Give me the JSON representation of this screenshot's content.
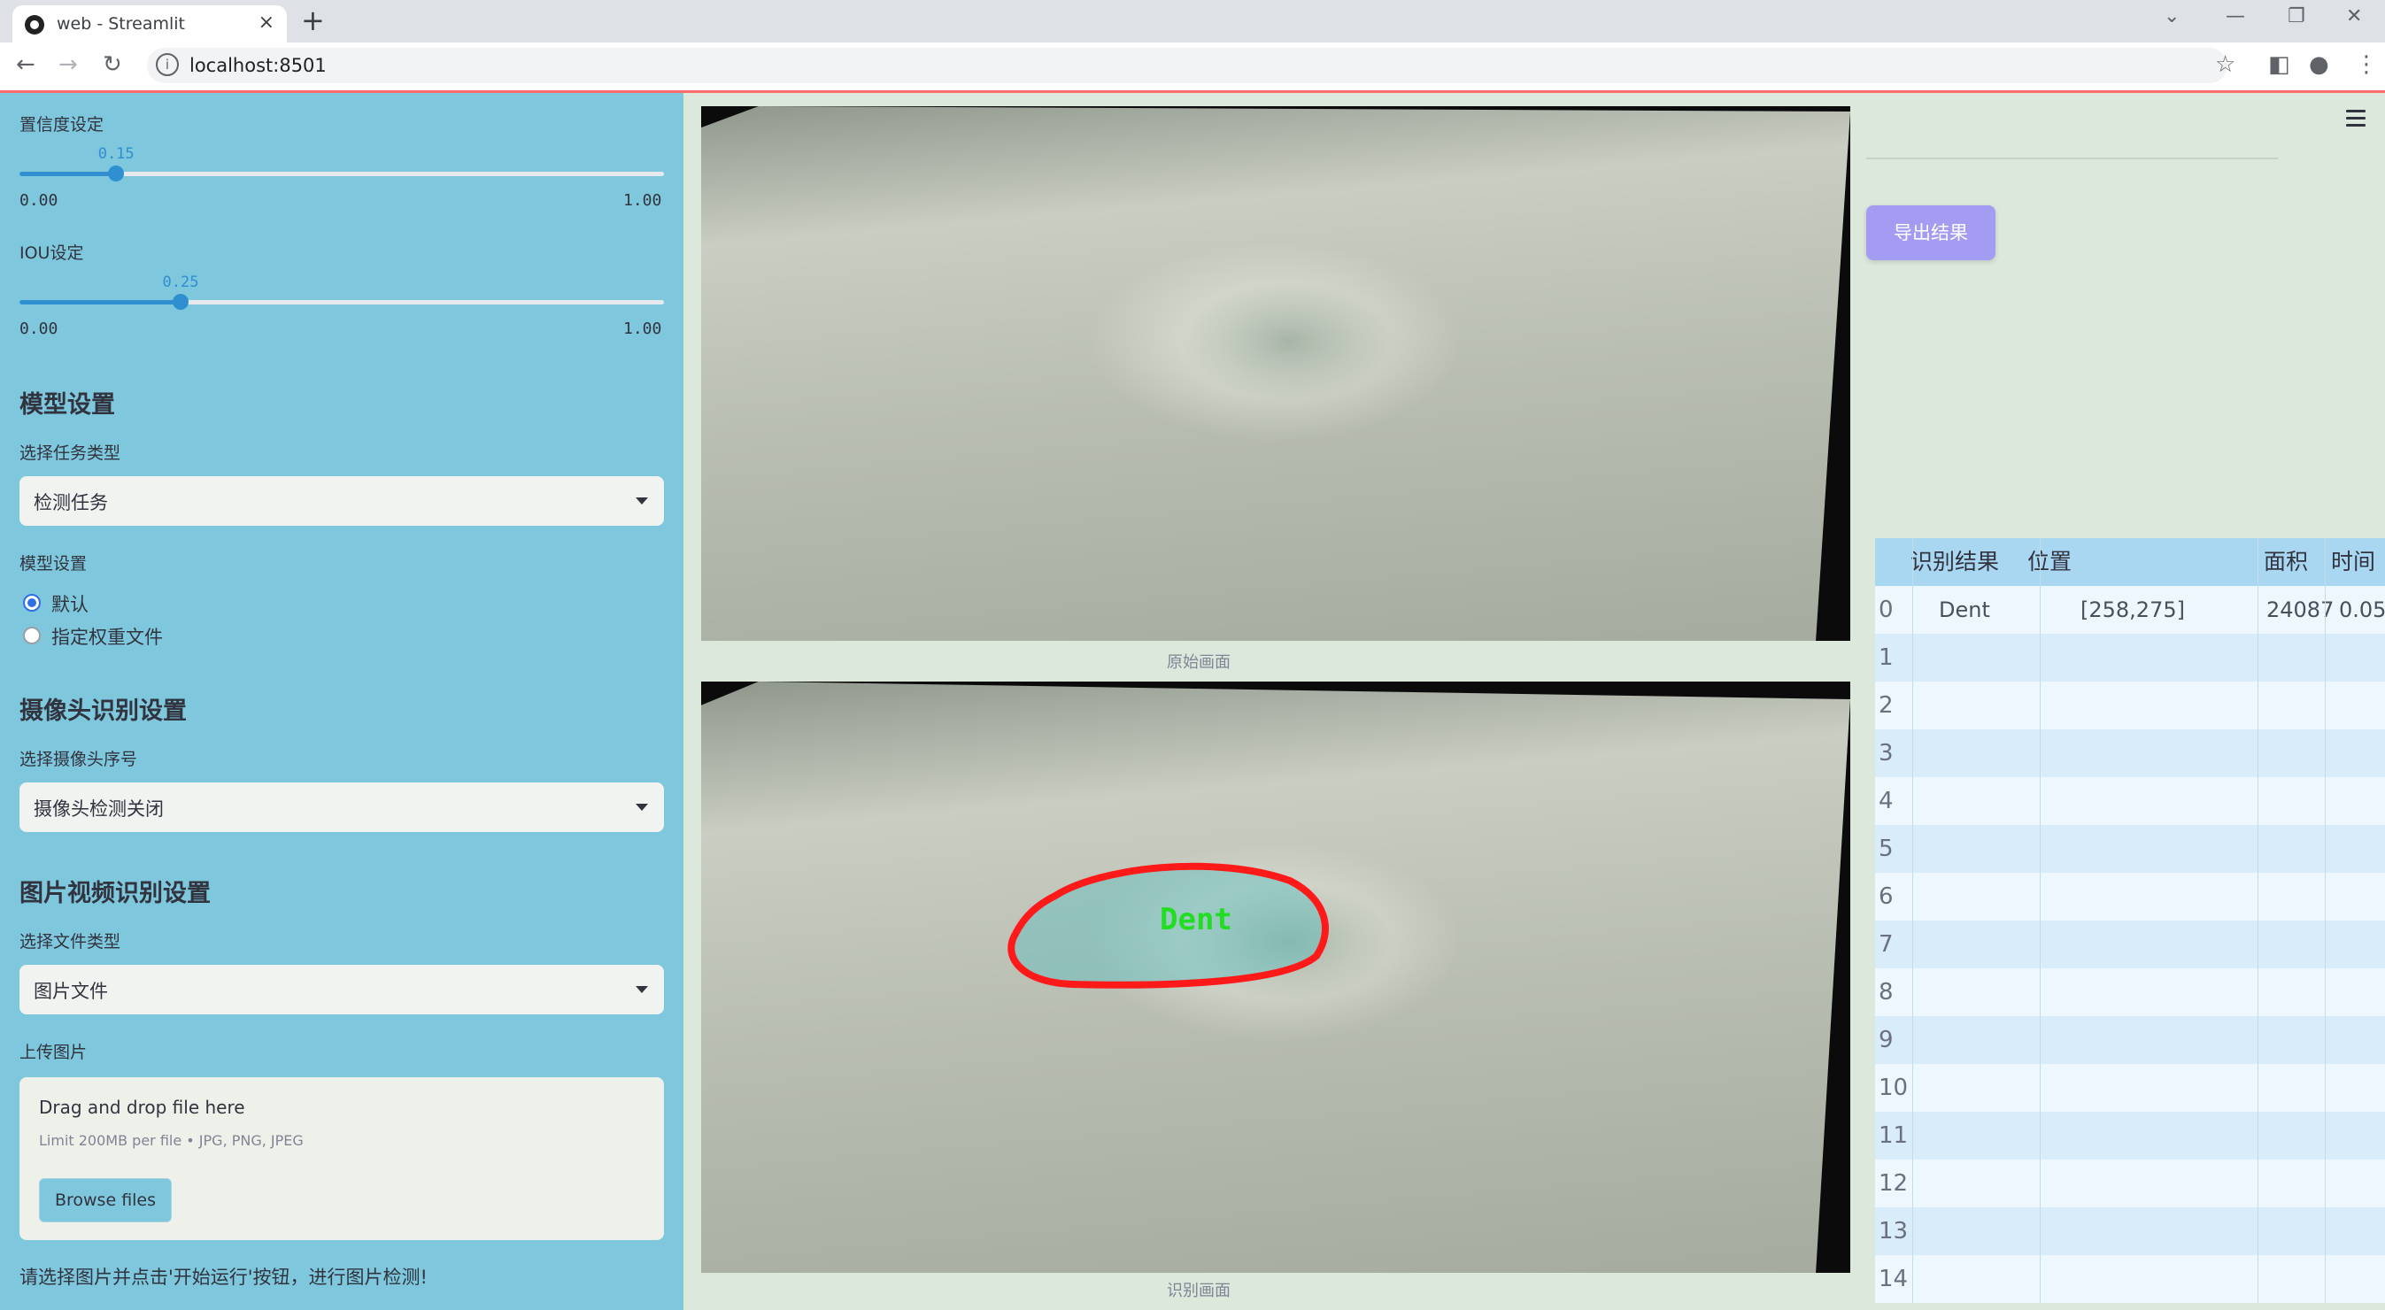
{
  "browser": {
    "tab_title": "web - Streamlit",
    "url": "localhost:8501"
  },
  "sidebar": {
    "confidence": {
      "label": "置信度设定",
      "value": "0.15",
      "fraction": 0.15,
      "min": "0.00",
      "max": "1.00"
    },
    "iou": {
      "label": "IOU设定",
      "value": "0.25",
      "fraction": 0.25,
      "min": "0.00",
      "max": "1.00"
    },
    "model_settings_heading": "模型设置",
    "task_type_label": "选择任务类型",
    "task_type_value": "检测任务",
    "model_label": "模型设置",
    "model_options": [
      {
        "label": "默认",
        "selected": true
      },
      {
        "label": "指定权重文件",
        "selected": false
      }
    ],
    "camera_heading": "摄像头识别设置",
    "camera_label": "选择摄像头序号",
    "camera_value": "摄像头检测关闭",
    "media_heading": "图片视频识别设置",
    "file_type_label": "选择文件类型",
    "file_type_value": "图片文件",
    "upload_label": "上传图片",
    "upload": {
      "title": "Drag and drop file here",
      "limit": "Limit 200MB per file • JPG, PNG, JPEG",
      "browse_label": "Browse files"
    },
    "hint": "请选择图片并点击'开始运行'按钮，进行图片检测!"
  },
  "main": {
    "original_caption": "原始画面",
    "result_caption": "识别画面",
    "detection_label": "Dent",
    "detection_color": "#ff1a1a",
    "detection_text_color": "#22dd22"
  },
  "right": {
    "export_label": "导出结果",
    "export_color": "#a49cf2",
    "table": {
      "columns": [
        "识别结果",
        "位置",
        "面积",
        "时间"
      ],
      "rows": [
        {
          "index": "0",
          "result": "Dent",
          "position": "[258,275]",
          "area": "24087",
          "time": "0.05"
        },
        {
          "index": "1",
          "result": "",
          "position": "",
          "area": "",
          "time": ""
        },
        {
          "index": "2",
          "result": "",
          "position": "",
          "area": "",
          "time": ""
        },
        {
          "index": "3",
          "result": "",
          "position": "",
          "area": "",
          "time": ""
        },
        {
          "index": "4",
          "result": "",
          "position": "",
          "area": "",
          "time": ""
        },
        {
          "index": "5",
          "result": "",
          "position": "",
          "area": "",
          "time": ""
        },
        {
          "index": "6",
          "result": "",
          "position": "",
          "area": "",
          "time": ""
        },
        {
          "index": "7",
          "result": "",
          "position": "",
          "area": "",
          "time": ""
        },
        {
          "index": "8",
          "result": "",
          "position": "",
          "area": "",
          "time": ""
        },
        {
          "index": "9",
          "result": "",
          "position": "",
          "area": "",
          "time": ""
        },
        {
          "index": "10",
          "result": "",
          "position": "",
          "area": "",
          "time": ""
        },
        {
          "index": "11",
          "result": "",
          "position": "",
          "area": "",
          "time": ""
        },
        {
          "index": "12",
          "result": "",
          "position": "",
          "area": "",
          "time": ""
        },
        {
          "index": "13",
          "result": "",
          "position": "",
          "area": "",
          "time": ""
        },
        {
          "index": "14",
          "result": "",
          "position": "",
          "area": "",
          "time": ""
        }
      ]
    }
  }
}
